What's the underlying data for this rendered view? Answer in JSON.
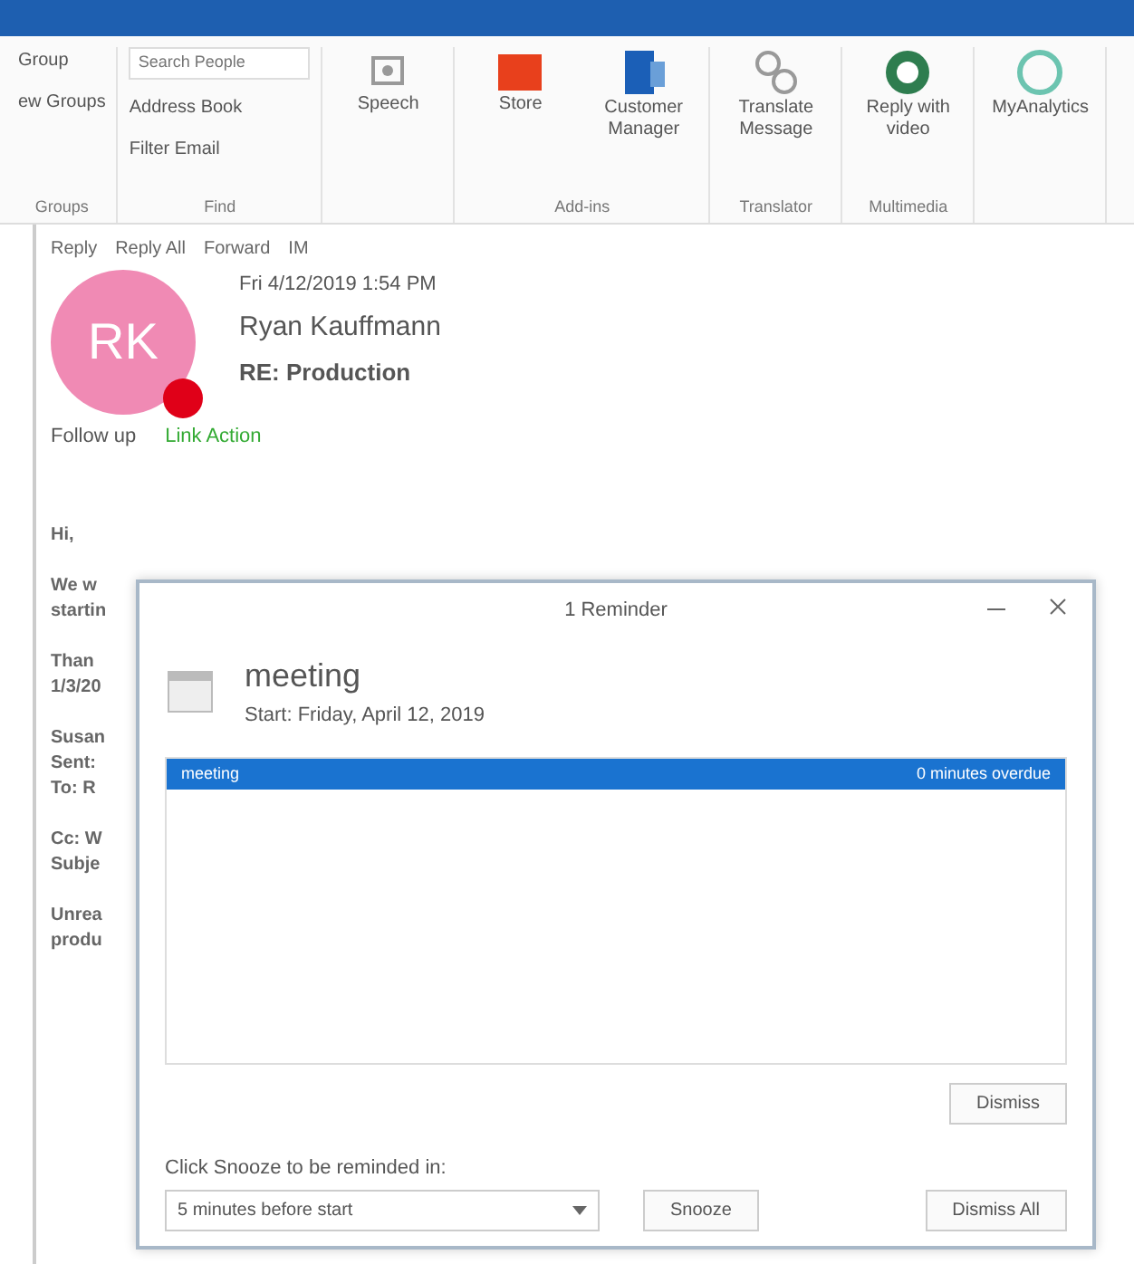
{
  "ribbon": {
    "groups": [
      {
        "label": "Groups",
        "items": [
          {
            "kind": "text",
            "label": "Group"
          },
          {
            "kind": "text",
            "label": "ew Groups"
          }
        ]
      },
      {
        "label": "Find",
        "items": [
          {
            "kind": "field",
            "placeholder": "Search People"
          },
          {
            "kind": "text",
            "label": "Address Book"
          },
          {
            "kind": "text",
            "label": "Filter Email"
          }
        ]
      },
      {
        "items": [
          {
            "kind": "big",
            "label": "Speech"
          }
        ]
      },
      {
        "label": "Add-ins",
        "items": [
          {
            "kind": "big",
            "label": "Store"
          },
          {
            "kind": "big",
            "label": "Customer Manager"
          }
        ]
      },
      {
        "label": "Translator",
        "items": [
          {
            "kind": "big",
            "label": "Translate Message"
          }
        ]
      },
      {
        "label": "Multimedia",
        "items": [
          {
            "kind": "big",
            "label": "Reply with video"
          }
        ]
      },
      {
        "items": [
          {
            "kind": "big",
            "label": "MyAnalytics"
          }
        ]
      }
    ]
  },
  "message": {
    "actions": [
      "Reply",
      "Reply All",
      "Forward",
      "IM"
    ],
    "date": "Fri 4/12/2019 1:54 PM",
    "initials": "RK",
    "sender": "Ryan Kauffmann",
    "subject": "RE: Production",
    "flag": "Follow up",
    "follow_label": "Link Action"
  },
  "body_paragraphs": [
    [
      "Hi,"
    ],
    [
      "We w",
      "startin"
    ],
    [
      "Than",
      "1/3/20"
    ],
    [
      "Susan",
      "Sent:",
      "To: R"
    ],
    [
      "Cc: W",
      "Subje"
    ],
    [
      "Unrea",
      "produ"
    ]
  ],
  "reminder": {
    "title": "1 Reminder",
    "subject": "meeting",
    "start": "Start: Friday, April 12, 2019",
    "items": [
      {
        "subject": "meeting",
        "due": "0 minutes overdue",
        "selected": true
      }
    ],
    "open_button": "Dismiss",
    "snooze_label": "Click Snooze to be reminded in:",
    "snooze_value": "5 minutes before start",
    "snooze_button": "Snooze",
    "dismiss_all_button": "Dismiss All"
  }
}
